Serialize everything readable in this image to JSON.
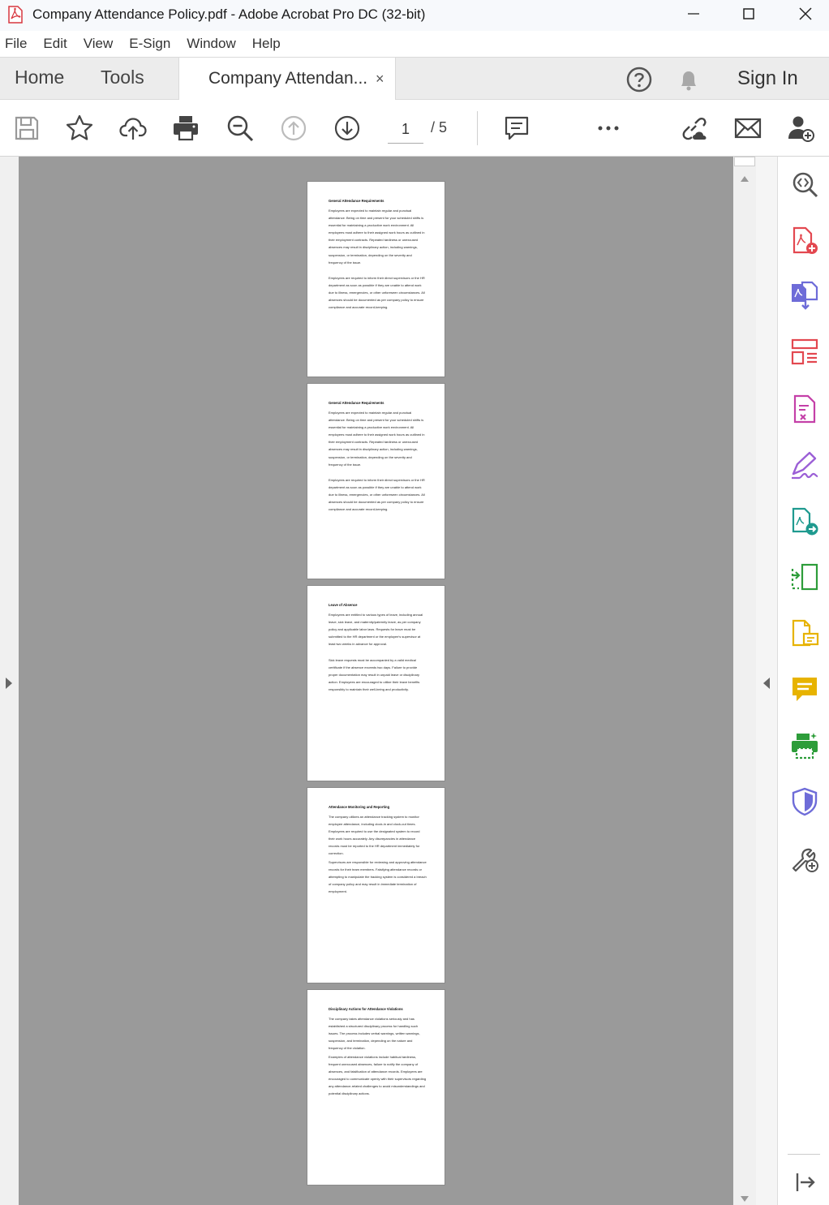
{
  "window": {
    "title": "Company Attendance Policy.pdf - Adobe Acrobat Pro DC (32-bit)",
    "app_icon": "acrobat-pdf-icon",
    "controls": [
      "minimize-icon",
      "maximize-icon",
      "close-icon"
    ]
  },
  "menu": {
    "items": [
      "File",
      "Edit",
      "View",
      "E-Sign",
      "Window",
      "Help"
    ]
  },
  "tabs": {
    "home": "Home",
    "tools": "Tools",
    "document": "Company Attendan...",
    "close_glyph": "×",
    "sign_in": "Sign In",
    "icons": [
      "help-icon",
      "notification-bell-icon"
    ]
  },
  "toolbar": {
    "icons": [
      "save-icon",
      "bookmark-star-icon",
      "upload-cloud-icon",
      "print-icon",
      "zoom-out-icon",
      "previous-page-icon",
      "next-page-icon",
      "comment-icon",
      "more-icon",
      "share-link-icon",
      "email-icon",
      "add-user-icon"
    ],
    "current_page": "1",
    "page_total": "/ 5"
  },
  "pages": [
    {
      "heading": "General Attendance Requirements",
      "paragraphs": [
        "Employees are expected to maintain regular and punctual attendance. Being on time and present for your scheduled shifts is essential for maintaining a productive work environment. All employees must adhere to their assigned work hours as outlined in their employment contracts. Repeated tardiness or unexcused absences may result in disciplinary action, including warnings, suspension, or termination, depending on the severity and frequency of the issue.",
        "Employees are required to inform their direct supervisors or the HR department as soon as possible if they are unable to attend work due to illness, emergencies, or other unforeseen circumstances. All absences should be documented as per company policy to ensure compliance and accurate record-keeping."
      ]
    },
    {
      "heading": "General Attendance Requirements",
      "paragraphs": [
        "Employees are expected to maintain regular and punctual attendance. Being on time and present for your scheduled shifts is essential for maintaining a productive work environment. All employees must adhere to their assigned work hours as outlined in their employment contracts. Repeated tardiness or unexcused absences may result in disciplinary action, including warnings, suspension, or termination, depending on the severity and frequency of the issue.",
        "Employees are required to inform their direct supervisors or the HR department as soon as possible if they are unable to attend work due to illness, emergencies, or other unforeseen circumstances. All absences should be documented as per company policy to ensure compliance and accurate record-keeping."
      ]
    },
    {
      "heading": "Leave of Absence",
      "paragraphs": [
        "Employees are entitled to various types of leave, including annual leave, sick leave, and maternity/paternity leave, as per company policy and applicable labor laws. Requests for leave must be submitted to the HR department or the employee's supervisor at least two weeks in advance for approval.",
        "Sick leave requests must be accompanied by a valid medical certificate if the absence exceeds two days. Failure to provide proper documentation may result in unpaid leave or disciplinary action. Employees are encouraged to utilize their leave benefits responsibly to maintain their well-being and productivity."
      ]
    },
    {
      "heading": "Attendance Monitoring and Reporting",
      "paragraphs": [
        "The company utilizes an attendance tracking system to monitor employee attendance, including clock-in and clock-out times. Employees are required to use the designated system to record their work hours accurately. Any discrepancies in attendance records must be reported to the HR department immediately for correction.",
        "Supervisors are responsible for reviewing and approving attendance records for their team members. Falsifying attendance records or attempting to manipulate the tracking system is considered a breach of company policy and may result in immediate termination of employment."
      ]
    },
    {
      "heading": "Disciplinary Actions for Attendance Violations",
      "paragraphs": [
        "The company takes attendance violations seriously and has established a structured disciplinary process for handling such issues. The process includes verbal warnings, written warnings, suspension, and termination, depending on the nature and frequency of the violation.",
        "Examples of attendance violations include habitual tardiness, frequent unexcused absences, failure to notify the company of absences, and falsification of attendance records. Employees are encouraged to communicate openly with their supervisors regarding any attendance-related challenges to avoid misunderstandings and potential disciplinary actions."
      ]
    }
  ],
  "tools_panel": {
    "icons": [
      "enhance-zoom-icon",
      "create-pdf-icon",
      "export-pdf-icon",
      "organize-pages-icon",
      "edit-pdf-form-icon",
      "fill-sign-icon",
      "send-for-review-icon",
      "compress-pdf-icon",
      "request-signatures-icon",
      "comment-icon",
      "print-production-icon",
      "protect-icon",
      "more-tools-icon",
      "collapse-panel-icon"
    ],
    "colors": {
      "red": "#e34850",
      "purple": "#6e6cd8",
      "magenta": "#c440a8",
      "teal": "#1f9a8f",
      "green": "#2d9d3a",
      "yellow": "#e7b300",
      "blue": "#6e6cd8",
      "gray": "#555555"
    }
  }
}
